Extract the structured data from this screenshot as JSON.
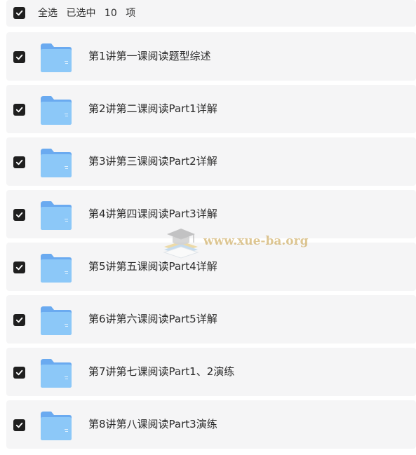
{
  "header": {
    "select_all": "全选",
    "selected_prefix": "已选中",
    "selected_count": "10",
    "selected_suffix": "项",
    "checked": true
  },
  "items": [
    {
      "label": "第1讲第一课阅读题型综述",
      "checked": true
    },
    {
      "label": "第2讲第二课阅读Part1详解",
      "checked": true
    },
    {
      "label": "第3讲第三课阅读Part2详解",
      "checked": true
    },
    {
      "label": "第4讲第四课阅读Part3详解",
      "checked": true
    },
    {
      "label": "第5讲第五课阅读Part4详解",
      "checked": true
    },
    {
      "label": "第6讲第六课阅读Part5详解",
      "checked": true
    },
    {
      "label": "第7讲第七课阅读Part1、2演练",
      "checked": true
    },
    {
      "label": "第8讲第八课阅读Part3演练",
      "checked": true
    }
  ],
  "watermark": {
    "text": "www.xue-ba.org",
    "icon": "graduation-cap-books-icon"
  },
  "colors": {
    "row_bg": "#f5f5f6",
    "checkbox": "#1f1f1f",
    "folder_light": "#8cc8f8",
    "folder_dark": "#6aaaf0"
  }
}
